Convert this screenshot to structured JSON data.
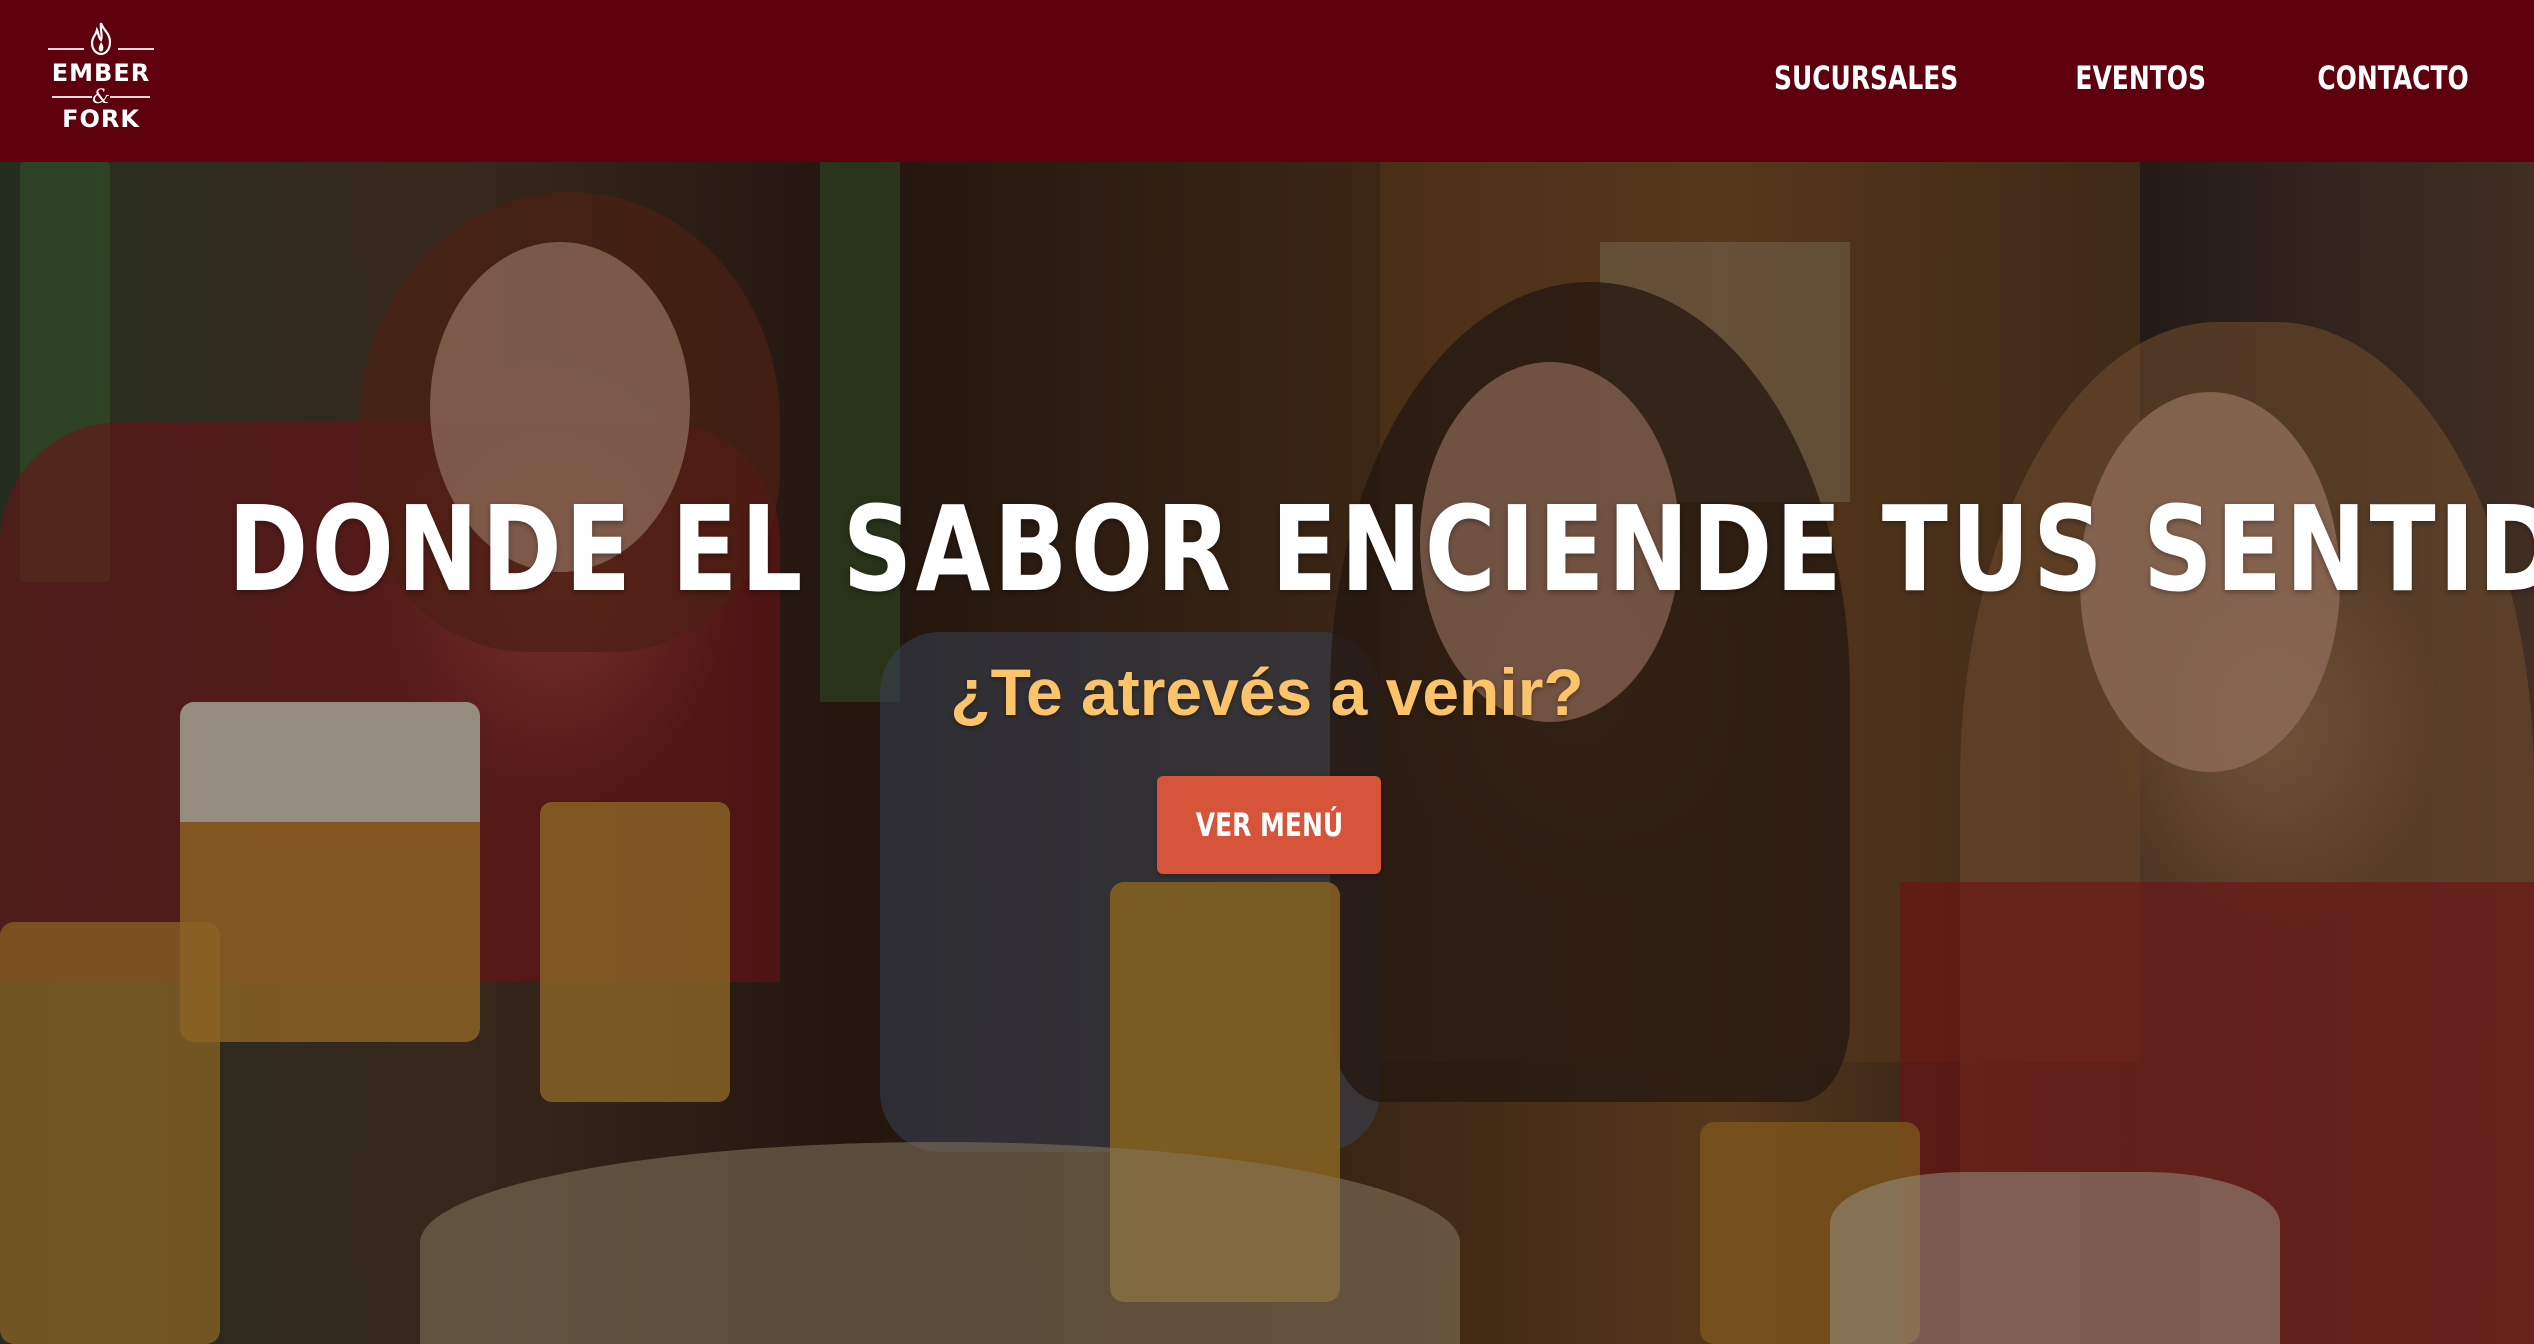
{
  "brand": {
    "line1": "EMBER",
    "ampersand": "&",
    "line2": "FORK"
  },
  "nav": {
    "items": [
      {
        "label": "SUCURSALES"
      },
      {
        "label": "EVENTOS"
      },
      {
        "label": "CONTACTO"
      }
    ]
  },
  "hero": {
    "title": "DONDE EL SABOR ENCIENDE TUS SENTIDOS",
    "subtitle": "¿Te atrevés a venir?",
    "cta_label": "VER MENÚ"
  },
  "colors": {
    "header_bg": "#5f000d",
    "subtitle": "#fcc46a",
    "cta_bg": "#d6543a",
    "text": "#ffffff"
  },
  "icons": {
    "logo_flame": "flame-icon"
  }
}
